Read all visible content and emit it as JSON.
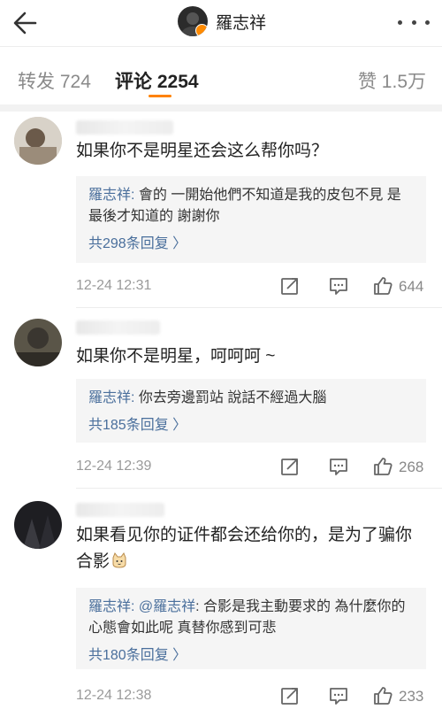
{
  "header": {
    "username": "羅志祥"
  },
  "tabs": {
    "repost": "转发 724",
    "comment": "评论 2254",
    "like": "赞 1.5万"
  },
  "comments": [
    {
      "text": "如果你不是明星还会这么帮你吗？",
      "reply_author": "羅志祥:",
      "reply_text": " 會的 一開始他們不知道是我的皮包不見 是最後才知道的 謝謝你",
      "reply_count": "共298条回复 〉",
      "time": "12-24 12:31",
      "likes": "644"
    },
    {
      "text": "如果你不是明星，呵呵呵 ~",
      "reply_author": "羅志祥:",
      "reply_text": " 你去旁邊罰站 說話不經過大腦",
      "reply_count": "共185条回复 〉",
      "time": "12-24 12:39",
      "likes": "268"
    },
    {
      "text": "如果看见你的证件都会还给你的，是为了骗你合影",
      "reply_author": "羅志祥:",
      "reply_mention": " @羅志祥",
      "reply_text": ":  合影是我主動要求的 為什麼你的心態會如此呢 真替你感到可悲",
      "reply_count": "共180条回复 〉",
      "time": "12-24 12:38",
      "likes": "233"
    }
  ],
  "colors": {
    "accent": "#ff8200",
    "link": "#4a6f9c",
    "meta": "#9a9a9a"
  },
  "icons": [
    "back-arrow-icon",
    "more-dots-icon",
    "verified-badge-icon",
    "forward-icon",
    "reply-icon",
    "like-icon",
    "cat-emoji-icon"
  ]
}
